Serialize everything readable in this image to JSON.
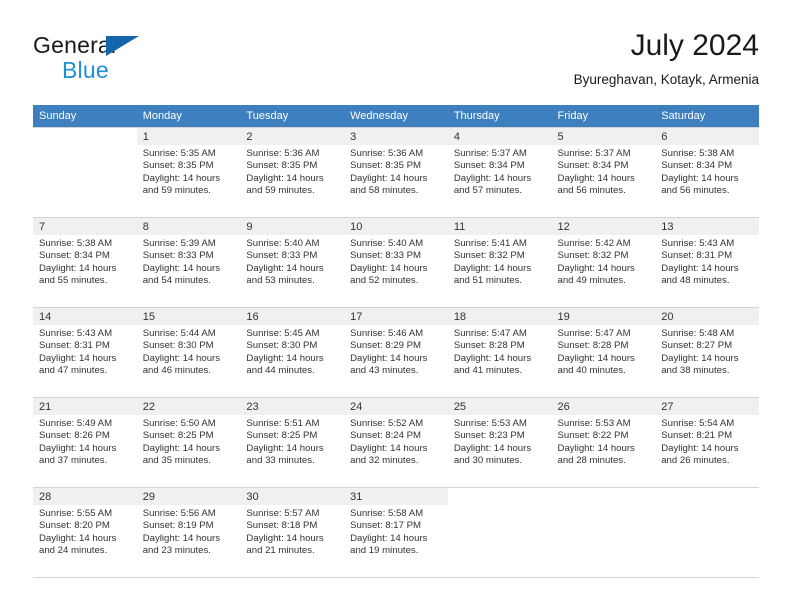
{
  "brand": {
    "name_top": "General",
    "name_bottom": "Blue",
    "accent_color": "#1f8fd6",
    "triangle_color": "#1565ad"
  },
  "header": {
    "title": "July 2024",
    "subtitle": "Byureghavan, Kotayk, Armenia"
  },
  "calendar": {
    "header_bg": "#3d7fbf",
    "daynum_bg": "#f0f0f0",
    "weekday_headers": [
      "Sunday",
      "Monday",
      "Tuesday",
      "Wednesday",
      "Thursday",
      "Friday",
      "Saturday"
    ],
    "labels": {
      "sunrise": "Sunrise:",
      "sunset": "Sunset:",
      "daylight": "Daylight:"
    },
    "weeks": [
      [
        {
          "day": ""
        },
        {
          "day": "1",
          "sunrise": "Sunrise: 5:35 AM",
          "sunset": "Sunset: 8:35 PM",
          "daylight": "Daylight: 14 hours and 59 minutes."
        },
        {
          "day": "2",
          "sunrise": "Sunrise: 5:36 AM",
          "sunset": "Sunset: 8:35 PM",
          "daylight": "Daylight: 14 hours and 59 minutes."
        },
        {
          "day": "3",
          "sunrise": "Sunrise: 5:36 AM",
          "sunset": "Sunset: 8:35 PM",
          "daylight": "Daylight: 14 hours and 58 minutes."
        },
        {
          "day": "4",
          "sunrise": "Sunrise: 5:37 AM",
          "sunset": "Sunset: 8:34 PM",
          "daylight": "Daylight: 14 hours and 57 minutes."
        },
        {
          "day": "5",
          "sunrise": "Sunrise: 5:37 AM",
          "sunset": "Sunset: 8:34 PM",
          "daylight": "Daylight: 14 hours and 56 minutes."
        },
        {
          "day": "6",
          "sunrise": "Sunrise: 5:38 AM",
          "sunset": "Sunset: 8:34 PM",
          "daylight": "Daylight: 14 hours and 56 minutes."
        }
      ],
      [
        {
          "day": "7",
          "sunrise": "Sunrise: 5:38 AM",
          "sunset": "Sunset: 8:34 PM",
          "daylight": "Daylight: 14 hours and 55 minutes."
        },
        {
          "day": "8",
          "sunrise": "Sunrise: 5:39 AM",
          "sunset": "Sunset: 8:33 PM",
          "daylight": "Daylight: 14 hours and 54 minutes."
        },
        {
          "day": "9",
          "sunrise": "Sunrise: 5:40 AM",
          "sunset": "Sunset: 8:33 PM",
          "daylight": "Daylight: 14 hours and 53 minutes."
        },
        {
          "day": "10",
          "sunrise": "Sunrise: 5:40 AM",
          "sunset": "Sunset: 8:33 PM",
          "daylight": "Daylight: 14 hours and 52 minutes."
        },
        {
          "day": "11",
          "sunrise": "Sunrise: 5:41 AM",
          "sunset": "Sunset: 8:32 PM",
          "daylight": "Daylight: 14 hours and 51 minutes."
        },
        {
          "day": "12",
          "sunrise": "Sunrise: 5:42 AM",
          "sunset": "Sunset: 8:32 PM",
          "daylight": "Daylight: 14 hours and 49 minutes."
        },
        {
          "day": "13",
          "sunrise": "Sunrise: 5:43 AM",
          "sunset": "Sunset: 8:31 PM",
          "daylight": "Daylight: 14 hours and 48 minutes."
        }
      ],
      [
        {
          "day": "14",
          "sunrise": "Sunrise: 5:43 AM",
          "sunset": "Sunset: 8:31 PM",
          "daylight": "Daylight: 14 hours and 47 minutes."
        },
        {
          "day": "15",
          "sunrise": "Sunrise: 5:44 AM",
          "sunset": "Sunset: 8:30 PM",
          "daylight": "Daylight: 14 hours and 46 minutes."
        },
        {
          "day": "16",
          "sunrise": "Sunrise: 5:45 AM",
          "sunset": "Sunset: 8:30 PM",
          "daylight": "Daylight: 14 hours and 44 minutes."
        },
        {
          "day": "17",
          "sunrise": "Sunrise: 5:46 AM",
          "sunset": "Sunset: 8:29 PM",
          "daylight": "Daylight: 14 hours and 43 minutes."
        },
        {
          "day": "18",
          "sunrise": "Sunrise: 5:47 AM",
          "sunset": "Sunset: 8:28 PM",
          "daylight": "Daylight: 14 hours and 41 minutes."
        },
        {
          "day": "19",
          "sunrise": "Sunrise: 5:47 AM",
          "sunset": "Sunset: 8:28 PM",
          "daylight": "Daylight: 14 hours and 40 minutes."
        },
        {
          "day": "20",
          "sunrise": "Sunrise: 5:48 AM",
          "sunset": "Sunset: 8:27 PM",
          "daylight": "Daylight: 14 hours and 38 minutes."
        }
      ],
      [
        {
          "day": "21",
          "sunrise": "Sunrise: 5:49 AM",
          "sunset": "Sunset: 8:26 PM",
          "daylight": "Daylight: 14 hours and 37 minutes."
        },
        {
          "day": "22",
          "sunrise": "Sunrise: 5:50 AM",
          "sunset": "Sunset: 8:25 PM",
          "daylight": "Daylight: 14 hours and 35 minutes."
        },
        {
          "day": "23",
          "sunrise": "Sunrise: 5:51 AM",
          "sunset": "Sunset: 8:25 PM",
          "daylight": "Daylight: 14 hours and 33 minutes."
        },
        {
          "day": "24",
          "sunrise": "Sunrise: 5:52 AM",
          "sunset": "Sunset: 8:24 PM",
          "daylight": "Daylight: 14 hours and 32 minutes."
        },
        {
          "day": "25",
          "sunrise": "Sunrise: 5:53 AM",
          "sunset": "Sunset: 8:23 PM",
          "daylight": "Daylight: 14 hours and 30 minutes."
        },
        {
          "day": "26",
          "sunrise": "Sunrise: 5:53 AM",
          "sunset": "Sunset: 8:22 PM",
          "daylight": "Daylight: 14 hours and 28 minutes."
        },
        {
          "day": "27",
          "sunrise": "Sunrise: 5:54 AM",
          "sunset": "Sunset: 8:21 PM",
          "daylight": "Daylight: 14 hours and 26 minutes."
        }
      ],
      [
        {
          "day": "28",
          "sunrise": "Sunrise: 5:55 AM",
          "sunset": "Sunset: 8:20 PM",
          "daylight": "Daylight: 14 hours and 24 minutes."
        },
        {
          "day": "29",
          "sunrise": "Sunrise: 5:56 AM",
          "sunset": "Sunset: 8:19 PM",
          "daylight": "Daylight: 14 hours and 23 minutes."
        },
        {
          "day": "30",
          "sunrise": "Sunrise: 5:57 AM",
          "sunset": "Sunset: 8:18 PM",
          "daylight": "Daylight: 14 hours and 21 minutes."
        },
        {
          "day": "31",
          "sunrise": "Sunrise: 5:58 AM",
          "sunset": "Sunset: 8:17 PM",
          "daylight": "Daylight: 14 hours and 19 minutes."
        },
        {
          "day": ""
        },
        {
          "day": ""
        },
        {
          "day": ""
        }
      ]
    ]
  }
}
